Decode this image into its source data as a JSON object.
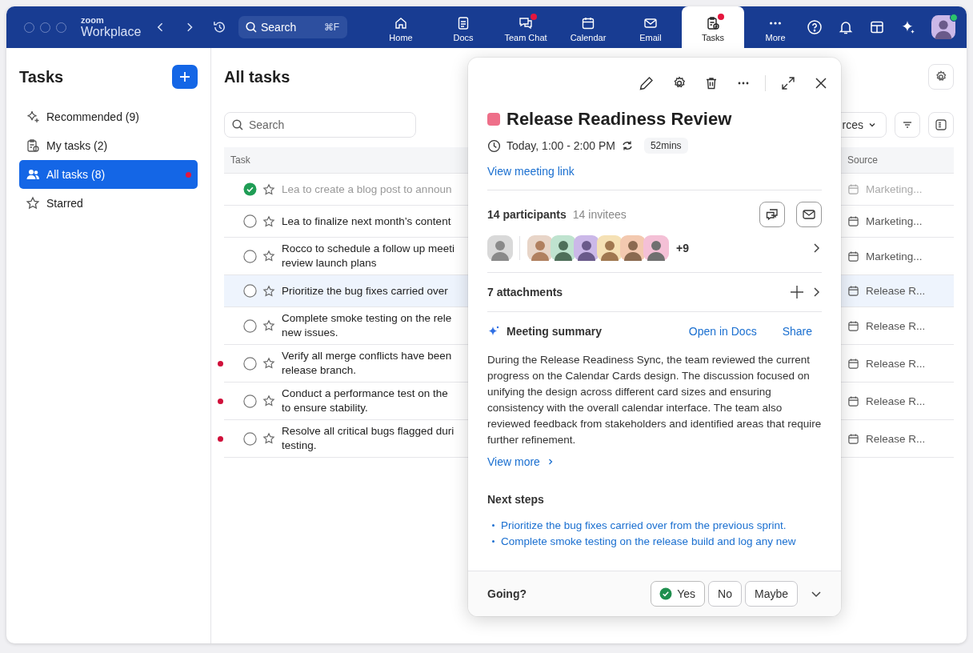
{
  "window": {
    "logo_small": "zoom",
    "logo": "Workplace"
  },
  "topbar": {
    "search": {
      "placeholder": "Search",
      "shortcut": "⌘F"
    },
    "tabs": [
      {
        "label": "Home",
        "selected": false,
        "badge": false
      },
      {
        "label": "Docs",
        "selected": false,
        "badge": false
      },
      {
        "label": "Team Chat",
        "selected": false,
        "badge": true
      },
      {
        "label": "Calendar",
        "selected": false,
        "badge": false
      },
      {
        "label": "Email",
        "selected": false,
        "badge": false
      },
      {
        "label": "Tasks",
        "selected": true,
        "badge": true
      },
      {
        "label": "More",
        "selected": false,
        "badge": false
      }
    ],
    "user": {
      "online": true
    }
  },
  "sidebar": {
    "title": "Tasks",
    "items": [
      {
        "label": "Recommended (9)",
        "selected": false,
        "badge": false
      },
      {
        "label": "My tasks (2)",
        "selected": false,
        "badge": false
      },
      {
        "label": "All tasks (8)",
        "selected": true,
        "badge": true
      },
      {
        "label": "Starred",
        "selected": false,
        "badge": false
      }
    ]
  },
  "main": {
    "title": "All tasks",
    "search": {
      "placeholder": "Search"
    },
    "sources_button": "rces",
    "columns": [
      "Task",
      "Source"
    ],
    "rows": [
      {
        "lines": [
          "Lea to create a blog post to announ"
        ],
        "source": "Marketing...",
        "done": true,
        "starred": false,
        "unread": false,
        "selected": false
      },
      {
        "lines": [
          "Lea to finalize next month’s content"
        ],
        "source": "Marketing...",
        "done": false,
        "starred": false,
        "unread": false,
        "selected": false
      },
      {
        "lines": [
          "Rocco to schedule a follow up meeti",
          "review launch plans"
        ],
        "source": "Marketing...",
        "done": false,
        "starred": false,
        "unread": false,
        "selected": false
      },
      {
        "lines": [
          "Prioritize the bug fixes carried over"
        ],
        "source": "Release R...",
        "done": false,
        "starred": false,
        "unread": false,
        "selected": true
      },
      {
        "lines": [
          "Complete smoke testing on the rele",
          "new issues."
        ],
        "source": "Release R...",
        "done": false,
        "starred": false,
        "unread": false,
        "selected": false
      },
      {
        "lines": [
          "Verify all merge conflicts have been",
          "release branch."
        ],
        "source": "Release R...",
        "done": false,
        "starred": false,
        "unread": true,
        "selected": false
      },
      {
        "lines": [
          "Conduct a performance test on the",
          "to ensure stability."
        ],
        "source": "Release R...",
        "done": false,
        "starred": false,
        "unread": true,
        "selected": false
      },
      {
        "lines": [
          "Resolve all critical bugs flagged duri",
          "testing."
        ],
        "source": "Release R...",
        "done": false,
        "starred": false,
        "unread": true,
        "selected": false
      }
    ]
  },
  "event": {
    "color": "#ee6f89",
    "title": "Release Readiness Review",
    "time": "Today, 1:00 - 2:00 PM",
    "recurring": true,
    "duration": "52mins",
    "link": "View meeting link",
    "participants": "14 participants",
    "invitees": "14 invitees",
    "avatars": [
      {
        "kind": "host"
      },
      {
        "kind": "guest"
      },
      {
        "kind": "guest"
      },
      {
        "kind": "guest"
      },
      {
        "kind": "guest"
      },
      {
        "kind": "guest"
      },
      {
        "kind": "guest"
      }
    ],
    "more_count": "+9",
    "attachments": "7 attachments",
    "summary": {
      "title": "Meeting summary",
      "open": "Open in Docs",
      "share": "Share",
      "text": "During the Release Readiness Sync, the team reviewed the current progress on the Calendar Cards design. The discussion focused on unifying the design across different card sizes and ensuring consistency with the overall calendar interface. The team also reviewed feedback from stakeholders and identified areas that require further refinement.",
      "view_more": "View more"
    },
    "next_steps": {
      "title": "Next steps",
      "items": [
        "Prioritize the bug fixes carried over from the previous sprint.",
        "Complete smoke testing on the release build and log any new"
      ]
    },
    "rsvp": {
      "label": "Going?",
      "options": [
        {
          "label": "Yes",
          "selected": true
        },
        {
          "label": "No",
          "selected": false
        },
        {
          "label": "Maybe",
          "selected": false
        }
      ]
    }
  }
}
